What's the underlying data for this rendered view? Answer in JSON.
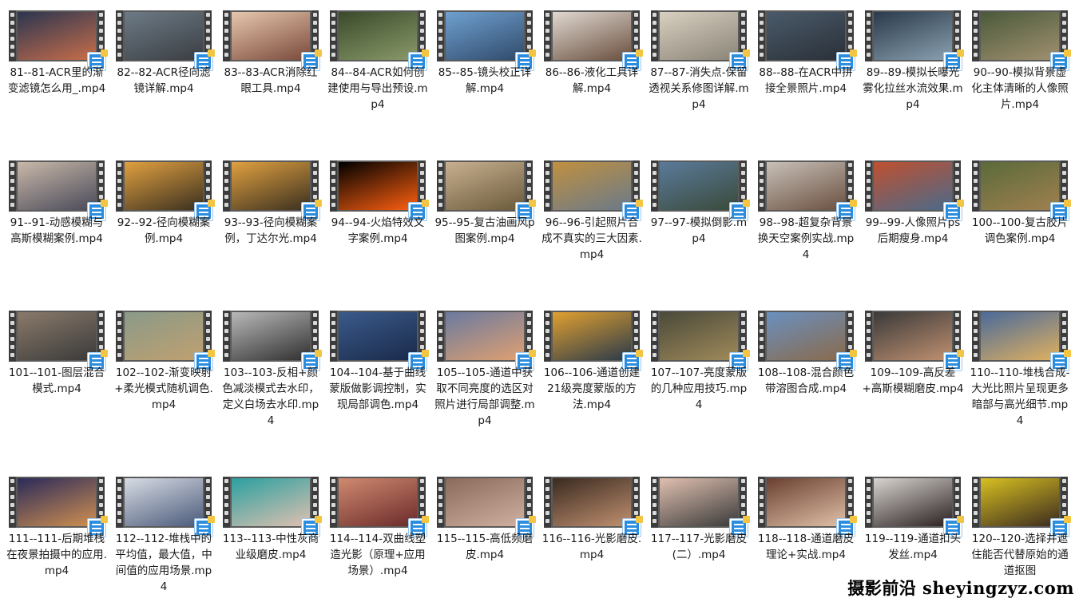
{
  "files": [
    {
      "label": "81--81-ACR里的渐变滤镜怎么用_.mp4",
      "colors": [
        "#2b3550",
        "#c86e4a"
      ]
    },
    {
      "label": "82--82-ACR径向滤镜详解.mp4",
      "colors": [
        "#6d7a86",
        "#3a3e42"
      ]
    },
    {
      "label": "83--83-ACR消除红眼工具.mp4",
      "colors": [
        "#e6c6ae",
        "#7a4a3a"
      ]
    },
    {
      "label": "84--84-ACR如何创建使用与导出预设.mp4",
      "colors": [
        "#3a4a2a",
        "#8a9a6a"
      ]
    },
    {
      "label": "85--85-镜头校正详解.mp4",
      "colors": [
        "#6fa0d0",
        "#304a6a"
      ]
    },
    {
      "label": "86--86-液化工具详解.mp4",
      "colors": [
        "#e0d8d0",
        "#6a5040"
      ]
    },
    {
      "label": "87--87-消失点-保留透视关系修图详解.mp4",
      "colors": [
        "#d8d0c0",
        "#8a8478"
      ]
    },
    {
      "label": "88--88-在ACR中拼接全景照片.mp4",
      "colors": [
        "#4a5a6a",
        "#2a3038"
      ]
    },
    {
      "label": "89--89-模拟长曝光雾化拉丝水流效果.mp4",
      "colors": [
        "#2a3a4a",
        "#8aa0b0"
      ]
    },
    {
      "label": "90--90-模拟背景虚化主体清晰的人像照片.mp4",
      "colors": [
        "#4a5a3a",
        "#a09070"
      ]
    },
    {
      "label": "91--91-动感模糊与高斯模糊案例.mp4",
      "colors": [
        "#c8b8a8",
        "#4a4a5a"
      ]
    },
    {
      "label": "92--92-径向模糊案例.mp4",
      "colors": [
        "#e0a040",
        "#3a3020"
      ]
    },
    {
      "label": "93--93-径向模糊案例，丁达尔光.mp4",
      "colors": [
        "#e0a040",
        "#3a3020"
      ]
    },
    {
      "label": "94--94-火焰特效文字案例.mp4",
      "colors": [
        "#000000",
        "#ff6010"
      ]
    },
    {
      "label": "95--95-复古油画风p图案例.mp4",
      "colors": [
        "#c8b090",
        "#6a5a3a"
      ]
    },
    {
      "label": "96--96-引起照片合成不真实的三大因素.mp4",
      "colors": [
        "#c09040",
        "#6a7a8a"
      ]
    },
    {
      "label": "97--97-模拟倒影.mp4",
      "colors": [
        "#5a7a9a",
        "#3a4a3a"
      ]
    },
    {
      "label": "98--98-超复杂背景换天空案例实战.mp4",
      "colors": [
        "#c8c0b8",
        "#6a5040"
      ]
    },
    {
      "label": "99--99-人像照片ps后期瘦身.mp4",
      "colors": [
        "#c05030",
        "#4a6a8a"
      ]
    },
    {
      "label": "100--100-复古胶片调色案例.mp4",
      "colors": [
        "#5a6a3a",
        "#a08050"
      ]
    },
    {
      "label": "101--101-图层混合模式.mp4",
      "colors": [
        "#8a7a6a",
        "#3a3a3a"
      ]
    },
    {
      "label": "102--102-渐变映射+柔光模式随机调色.mp4",
      "colors": [
        "#8a9a88",
        "#c0a070"
      ]
    },
    {
      "label": "103--103-反相+颜色减淡模式去水印，定义白场去水印.mp4",
      "colors": [
        "#b8b8b8",
        "#303030"
      ]
    },
    {
      "label": "104--104-基于曲线蒙版做影调控制，实现局部调色.mp4",
      "colors": [
        "#3a5a8a",
        "#1a2a4a"
      ]
    },
    {
      "label": "105--105-通道中获取不同亮度的选区对照片进行局部调整.mp4",
      "colors": [
        "#6a7aa0",
        "#e0a070"
      ]
    },
    {
      "label": "106--106-通道创建21级亮度蒙版的方法.mp4",
      "colors": [
        "#e0a030",
        "#2a3a4a"
      ]
    },
    {
      "label": "107--107-亮度蒙版的几种应用技巧.mp4",
      "colors": [
        "#4a4a3a",
        "#a08a5a"
      ]
    },
    {
      "label": "108--108-混合颜色带溶图合成.mp4",
      "colors": [
        "#6a90c0",
        "#8a6a4a"
      ]
    },
    {
      "label": "109--109-高反差+高斯模糊磨皮.mp4",
      "colors": [
        "#3a3a3a",
        "#c09070"
      ]
    },
    {
      "label": "110--110-堆栈合成-大光比照片呈现更多暗部与高光细节.mp4",
      "colors": [
        "#4a6a9a",
        "#e0b060"
      ]
    },
    {
      "label": "111--111-后期堆栈在夜景拍摄中的应用.mp4",
      "colors": [
        "#2a2a5a",
        "#d09050"
      ]
    },
    {
      "label": "112--112-堆栈中的平均值，最大值，中间值的应用场景.mp4",
      "colors": [
        "#d8dce4",
        "#4a5a7a"
      ]
    },
    {
      "label": "113--113-中性灰商业级磨皮.mp4",
      "colors": [
        "#2aa0a0",
        "#e0c0b0"
      ]
    },
    {
      "label": "114--114-双曲线塑造光影（原理+应用场景）.mp4",
      "colors": [
        "#d08a70",
        "#6a2a2a"
      ]
    },
    {
      "label": "115--115-高低频磨皮.mp4",
      "colors": [
        "#8a6a5a",
        "#d0b0a0"
      ]
    },
    {
      "label": "116--116-光影磨皮.mp4",
      "colors": [
        "#3a2a20",
        "#c09070"
      ]
    },
    {
      "label": "117--117-光影磨皮(二）.mp4",
      "colors": [
        "#e0c0b0",
        "#3a3a3a"
      ]
    },
    {
      "label": "118--118-通道磨皮理论+实战.mp4",
      "colors": [
        "#6a4030",
        "#e0c0a8"
      ]
    },
    {
      "label": "119--119-通道扣头发丝.mp4",
      "colors": [
        "#d8d4d0",
        "#2a2020"
      ]
    },
    {
      "label": "120--120-选择并遮住能否代替原始的通道抠图",
      "colors": [
        "#d8c020",
        "#3a2a20"
      ]
    }
  ],
  "watermark": "摄影前沿 sheyingzyz.com"
}
